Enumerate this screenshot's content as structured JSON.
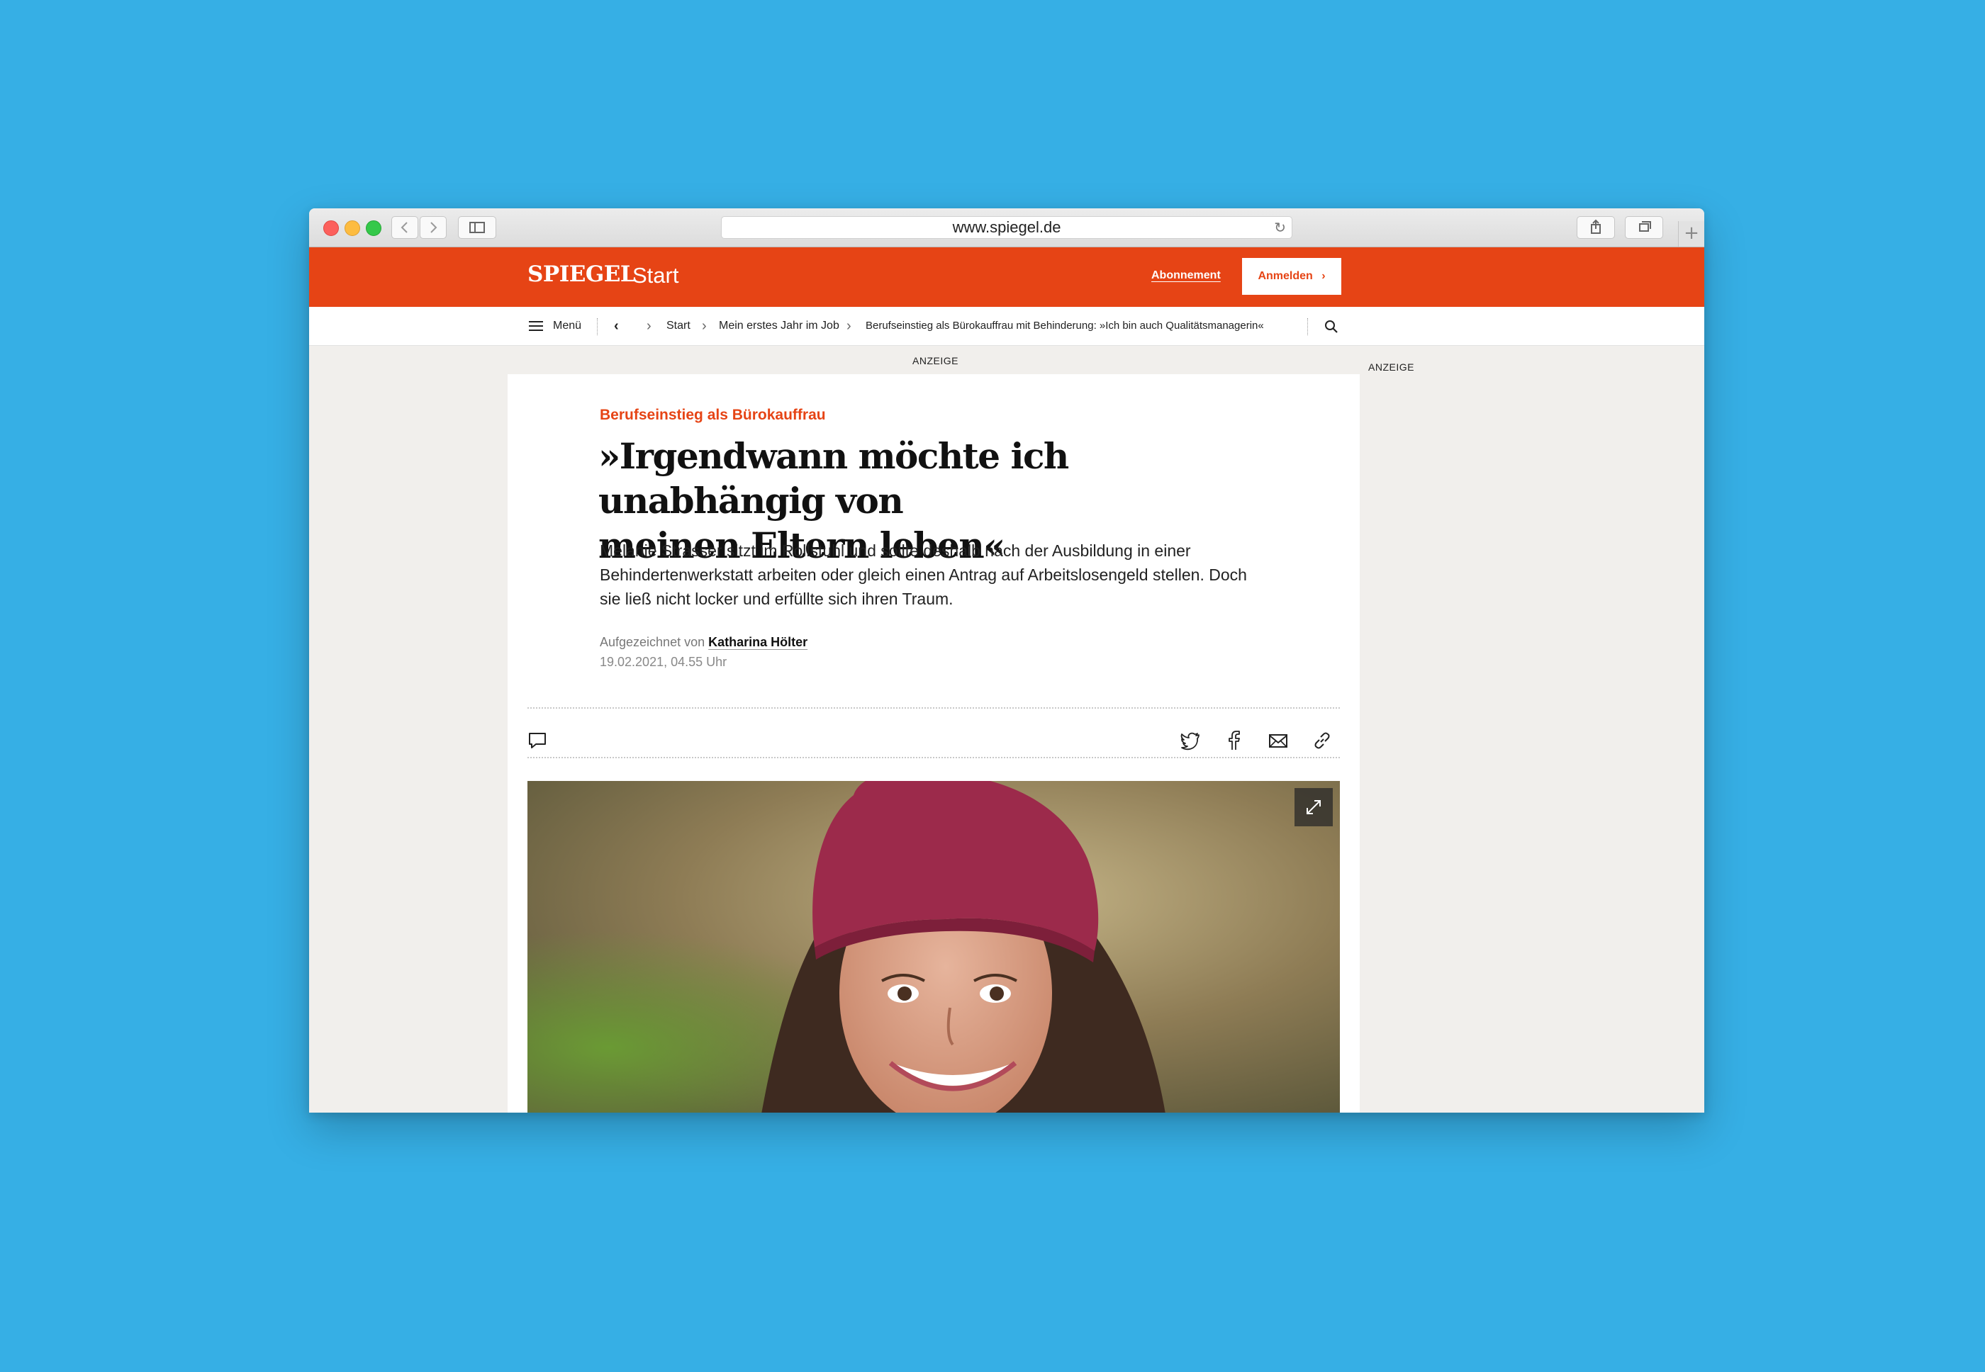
{
  "browser": {
    "url": "www.spiegel.de",
    "back_icon": "chevron-left-icon",
    "forward_icon": "chevron-right-icon",
    "sidebar_icon": "sidebar-icon",
    "reload_icon": "reload-icon",
    "share_icon": "share-icon",
    "tabs_icon": "tabs-icon",
    "newtab_icon": "plus-icon"
  },
  "header": {
    "logo": "SPIEGEL",
    "section": "Start",
    "subscription_link": "Abonnement",
    "login_button": "Anmelden",
    "brand_color": "#e64415"
  },
  "nav": {
    "menu_label": "Menü",
    "breadcrumbs": [
      "Start",
      "Mein erstes Jahr im Job",
      "Berufseinstieg als Bürokauffrau mit Behinderung: »Ich bin auch Qualitätsmanagerin«"
    ]
  },
  "ads": {
    "top_label": "ANZEIGE",
    "side_label": "ANZEIGE"
  },
  "article": {
    "kicker": "Berufseinstieg als Bürokauffrau",
    "headline_line1": "»Irgendwann möchte ich unabhängig von",
    "headline_line2": "meinen Eltern leben«",
    "teaser": "Melanie Strasser sitzt im Rollstuhl und sollte deshalb nach der Ausbildung in einer Behindertenwerkstatt arbeiten oder gleich einen Antrag auf Arbeitslosengeld stellen. Doch sie ließ nicht locker und erfüllte sich ihren Traum.",
    "byline_prefix": "Aufgezeichnet von",
    "author": "Katharina Hölter",
    "date": "19.02.2021, 04.55 Uhr",
    "share_icons": [
      "comment-icon",
      "twitter-icon",
      "facebook-icon",
      "mail-icon",
      "link-icon"
    ]
  }
}
